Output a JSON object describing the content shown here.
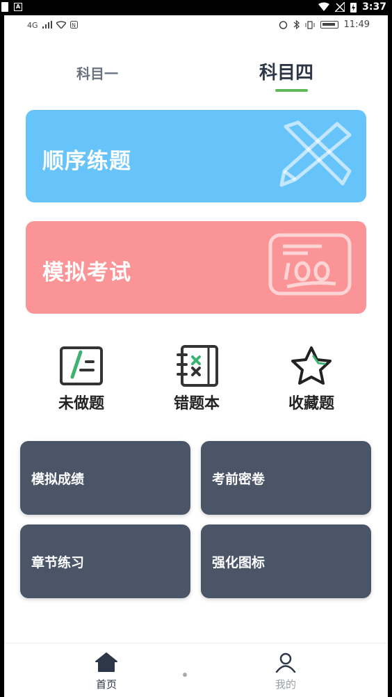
{
  "system_bar": {
    "time": "3:37"
  },
  "inner_status": {
    "left_text": "4G",
    "time": "11:49"
  },
  "tabs": [
    {
      "label": "科目一",
      "active": false
    },
    {
      "label": "科目四",
      "active": true
    }
  ],
  "cards": {
    "sequential_practice": {
      "label": "顺序练题",
      "color": "#66c4fb",
      "icon": "pencil-ruler-icon"
    },
    "mock_exam": {
      "label": "模拟考试",
      "color": "#fb9496",
      "icon": "score-100-icon"
    }
  },
  "shortcuts": [
    {
      "label": "未做题",
      "icon": "undone-questions-icon"
    },
    {
      "label": "错题本",
      "icon": "wrong-notebook-icon"
    },
    {
      "label": "收藏题",
      "icon": "star-icon"
    }
  ],
  "grid_buttons": [
    {
      "label": "模拟成绩"
    },
    {
      "label": "考前密卷"
    },
    {
      "label": "章节练习"
    },
    {
      "label": "强化图标"
    }
  ],
  "bottom_nav": [
    {
      "label": "首页",
      "icon": "home-icon",
      "active": true
    },
    {
      "label": "我的",
      "icon": "user-icon",
      "active": false
    }
  ],
  "colors": {
    "accent_green": "#5fb85a",
    "grid_button": "#4a5568",
    "text_dark": "#2d3748"
  }
}
